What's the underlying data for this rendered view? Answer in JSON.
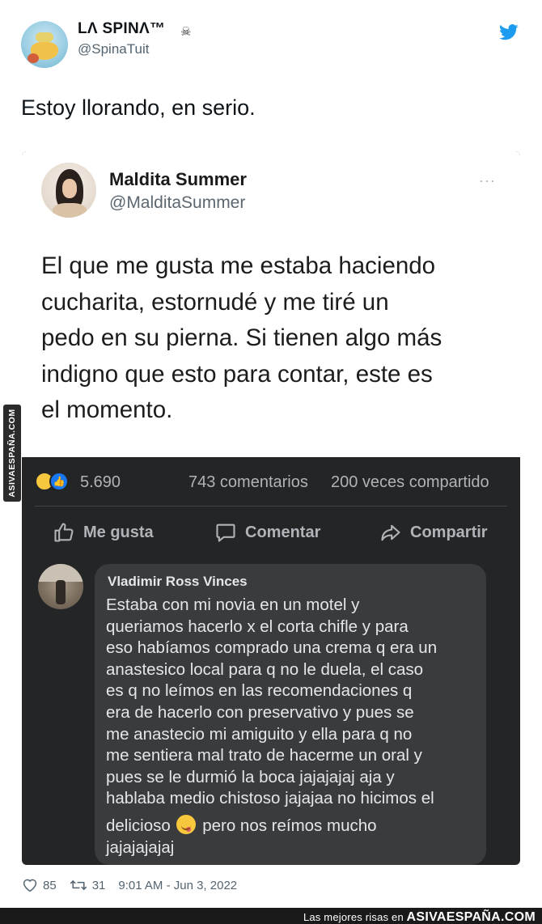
{
  "tweet": {
    "author": {
      "name": "LΛ SPINΛ™",
      "name_suffix": "☠",
      "handle": "@SpinaTuit"
    },
    "text": "Estoy llorando, en serio.",
    "likes": "85",
    "retweets": "31",
    "timestamp": "9:01 AM - Jun 3, 2022",
    "icons": {
      "brand": "twitter-bird-icon",
      "like": "heart-icon",
      "retweet": "retweet-icon"
    },
    "colors": {
      "twitter_blue": "#1d9bf0",
      "meta_gray": "#536471"
    }
  },
  "embedded_tweet": {
    "name": "Maldita Summer",
    "handle": "@MalditaSummer",
    "more": "···",
    "text_lines": [
      "El que me gusta me estaba haciendo",
      "cucharita, estornudé y me tiré un",
      "pedo en su pierna. Si tienen algo más",
      "indigno que esto para contar, este es",
      "el momento."
    ]
  },
  "facebook": {
    "reaction_count": "5.690",
    "comments": "743 comentarios",
    "shares": "200 veces compartido",
    "actions": {
      "like": "Me gusta",
      "comment": "Comentar",
      "share": "Compartir"
    },
    "comment": {
      "author": "Vladimir Ross Vinces",
      "lines": [
        "Estaba con mi novia en un motel y",
        "queriamos hacerlo x el corta chifle y para",
        "eso habíamos comprado una crema q era un",
        "anastesico local para q no le duela, el caso",
        "es q no leímos  en las recomendaciones  q",
        "era de hacerlo con preservativo y pues se",
        "me anastecio mi amiguito y ella para q  no",
        "me  sentiera mal trato de hacerme un oral  y",
        "pues se le durmió la boca jajajajaj aja y",
        "hablaba medio chistoso jajajaa no hicimos el"
      ],
      "line_before_emoji": "delicioso",
      "line_after_emoji": "pero nos reímos mucho",
      "last_line": "jajajajajaj"
    },
    "colors": {
      "dark_bg": "#242526",
      "bubble": "#3a3b3c",
      "text": "#e4e6eb",
      "muted": "#b0b3b8"
    }
  },
  "watermark": {
    "side": "ASIVAESPAÑA.COM"
  },
  "footer": {
    "prefix": "Las mejores risas en",
    "brand": "ASIVAESPAÑA.COM"
  }
}
